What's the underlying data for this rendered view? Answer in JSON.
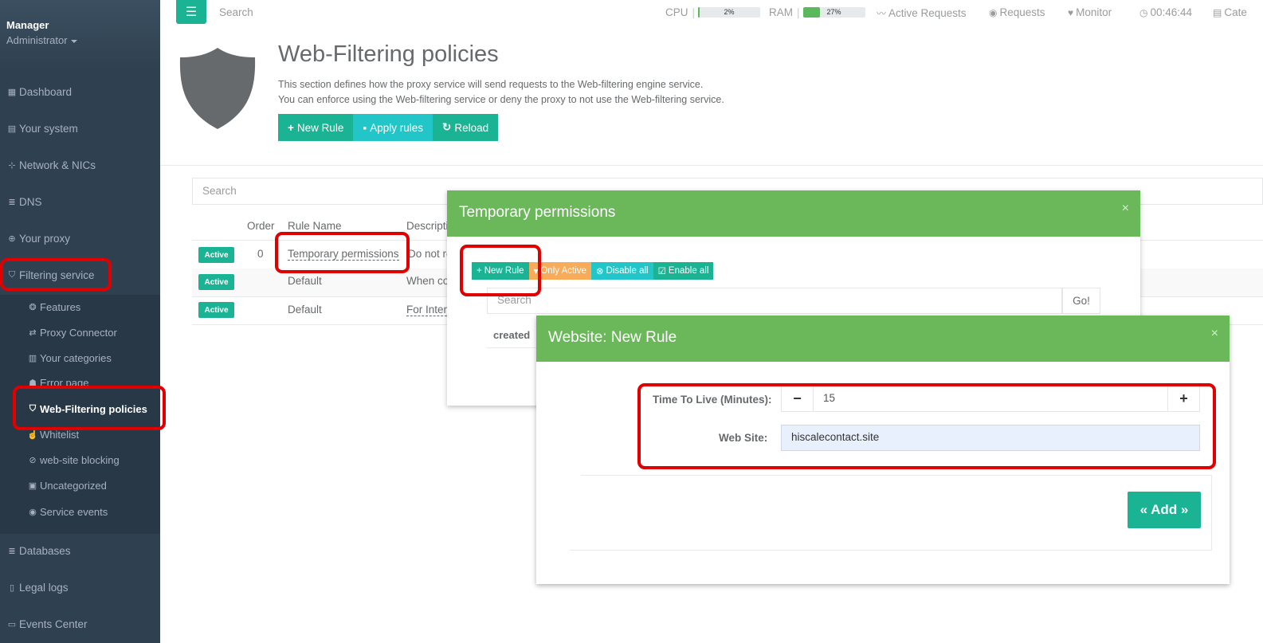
{
  "sidebar": {
    "profile": {
      "name": "Manager",
      "role": "Administrator"
    },
    "items": [
      {
        "label": "Dashboard",
        "icon": "dashboard-icon"
      },
      {
        "label": "Your system",
        "icon": "server-icon"
      },
      {
        "label": "Network & NICs",
        "icon": "sitemap-icon"
      },
      {
        "label": "DNS",
        "icon": "database-icon"
      },
      {
        "label": "Your proxy",
        "icon": "globe-icon"
      },
      {
        "label": "Filtering service",
        "icon": "shield-icon"
      }
    ],
    "subitems": [
      {
        "label": "Features",
        "icon": "cog-icon"
      },
      {
        "label": "Proxy Connector",
        "icon": "exchange-icon"
      },
      {
        "label": "Your categories",
        "icon": "books-icon"
      },
      {
        "label": "Error page",
        "icon": "user-icon"
      },
      {
        "label": "Web-Filtering policies",
        "icon": "shield-icon",
        "active": true
      },
      {
        "label": "Whitelist",
        "icon": "thumbs-up-icon"
      },
      {
        "label": "web-site blocking",
        "icon": "ban-icon"
      },
      {
        "label": "Uncategorized",
        "icon": "hdd-icon"
      },
      {
        "label": "Service events",
        "icon": "eye-icon"
      }
    ],
    "bottom_items": [
      {
        "label": "Databases",
        "icon": "database-icon"
      },
      {
        "label": "Legal logs",
        "icon": "file-icon"
      },
      {
        "label": "Events Center",
        "icon": "book-icon"
      }
    ]
  },
  "topbar": {
    "search_placeholder": "Search",
    "cpu_label": "CPU",
    "cpu_percent": "2%",
    "cpu_value": 2,
    "ram_label": "RAM",
    "ram_percent": "27%",
    "ram_value": 27,
    "active_requests": "Active Requests",
    "requests": "Requests",
    "monitor": "Monitor",
    "clock": "00:46:44",
    "categories": "Cate"
  },
  "header": {
    "title": "Web-Filtering policies",
    "desc_line1": "This section defines how the proxy service will send requests to the Web-filtering engine service.",
    "desc_line2": "You can enforce using the Web-filtering service or deny the proxy to not use the Web-filtering service.",
    "btn_new_rule": "New Rule",
    "btn_apply": "Apply rules",
    "btn_reload": "Reload"
  },
  "table": {
    "search_placeholder": "Search",
    "headers": {
      "order": "Order",
      "rule_name": "Rule Name",
      "description": "Descripti"
    },
    "rows": [
      {
        "status": "Active",
        "order": "0",
        "rule_name": "Temporary permissions",
        "description": "Do not re"
      },
      {
        "status": "Active",
        "order": "",
        "rule_name": "Default",
        "description": "When co"
      },
      {
        "status": "Active",
        "order": "",
        "rule_name": "Default",
        "description": "For Inter"
      }
    ]
  },
  "modal_temp": {
    "title": "Temporary permissions",
    "close": "×",
    "btn_new_rule": "New Rule",
    "btn_only_active": "Only Active",
    "btn_disable_all": "Disable all",
    "btn_enable_all": "Enable all",
    "search_placeholder": "Search",
    "go": "Go!",
    "col_created": "created"
  },
  "modal_new": {
    "title": "Website: New Rule",
    "close": "×",
    "ttl_label": "Time To Live (Minutes):",
    "ttl_value": "15",
    "minus": "−",
    "plus": "+",
    "site_label": "Web Site:",
    "site_value": "hiscalecontact.site",
    "add_button": "« Add »"
  },
  "colors": {
    "sidebar": "#2f4050",
    "primary": "#1ab394",
    "info": "#23c6c8",
    "warning": "#f8ac59",
    "modal_header": "#6ab85a",
    "highlight": "#e00000"
  }
}
